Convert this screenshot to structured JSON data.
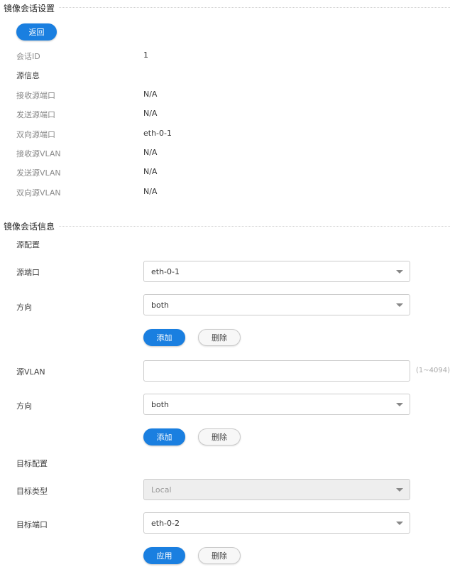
{
  "section1": {
    "title": "镜像会话设置",
    "back_button": "返回",
    "session_id_label": "会话ID",
    "session_id_value": "1",
    "source_info_heading": "源信息",
    "rows": [
      {
        "label": "接收源端口",
        "value": "N/A"
      },
      {
        "label": "发送源端口",
        "value": "N/A"
      },
      {
        "label": "双向源端口",
        "value": "eth-0-1"
      },
      {
        "label": "接收源VLAN",
        "value": "N/A"
      },
      {
        "label": "发送源VLAN",
        "value": "N/A"
      },
      {
        "label": "双向源VLAN",
        "value": "N/A"
      }
    ]
  },
  "section2": {
    "title": "镜像会话信息",
    "source_config_heading": "源配置",
    "source_port": {
      "label": "源端口",
      "value": "eth-0-1"
    },
    "port_direction": {
      "label": "方向",
      "value": "both"
    },
    "port_add_button": "添加",
    "port_delete_button": "删除",
    "source_vlan": {
      "label": "源VLAN",
      "value": "",
      "hint": "(1~4094)"
    },
    "vlan_direction": {
      "label": "方向",
      "value": "both"
    },
    "vlan_add_button": "添加",
    "vlan_delete_button": "删除",
    "target_config_heading": "目标配置",
    "target_type": {
      "label": "目标类型",
      "value": "Local"
    },
    "target_port": {
      "label": "目标端口",
      "value": "eth-0-2"
    },
    "apply_button": "应用",
    "target_delete_button": "删除"
  },
  "colors": {
    "primary": "#1a7fe0",
    "secondary_bg": "#f7f7f7",
    "disabled_bg": "#eeeeee"
  },
  "icons": {
    "dropdown": "chevron-down-icon"
  }
}
